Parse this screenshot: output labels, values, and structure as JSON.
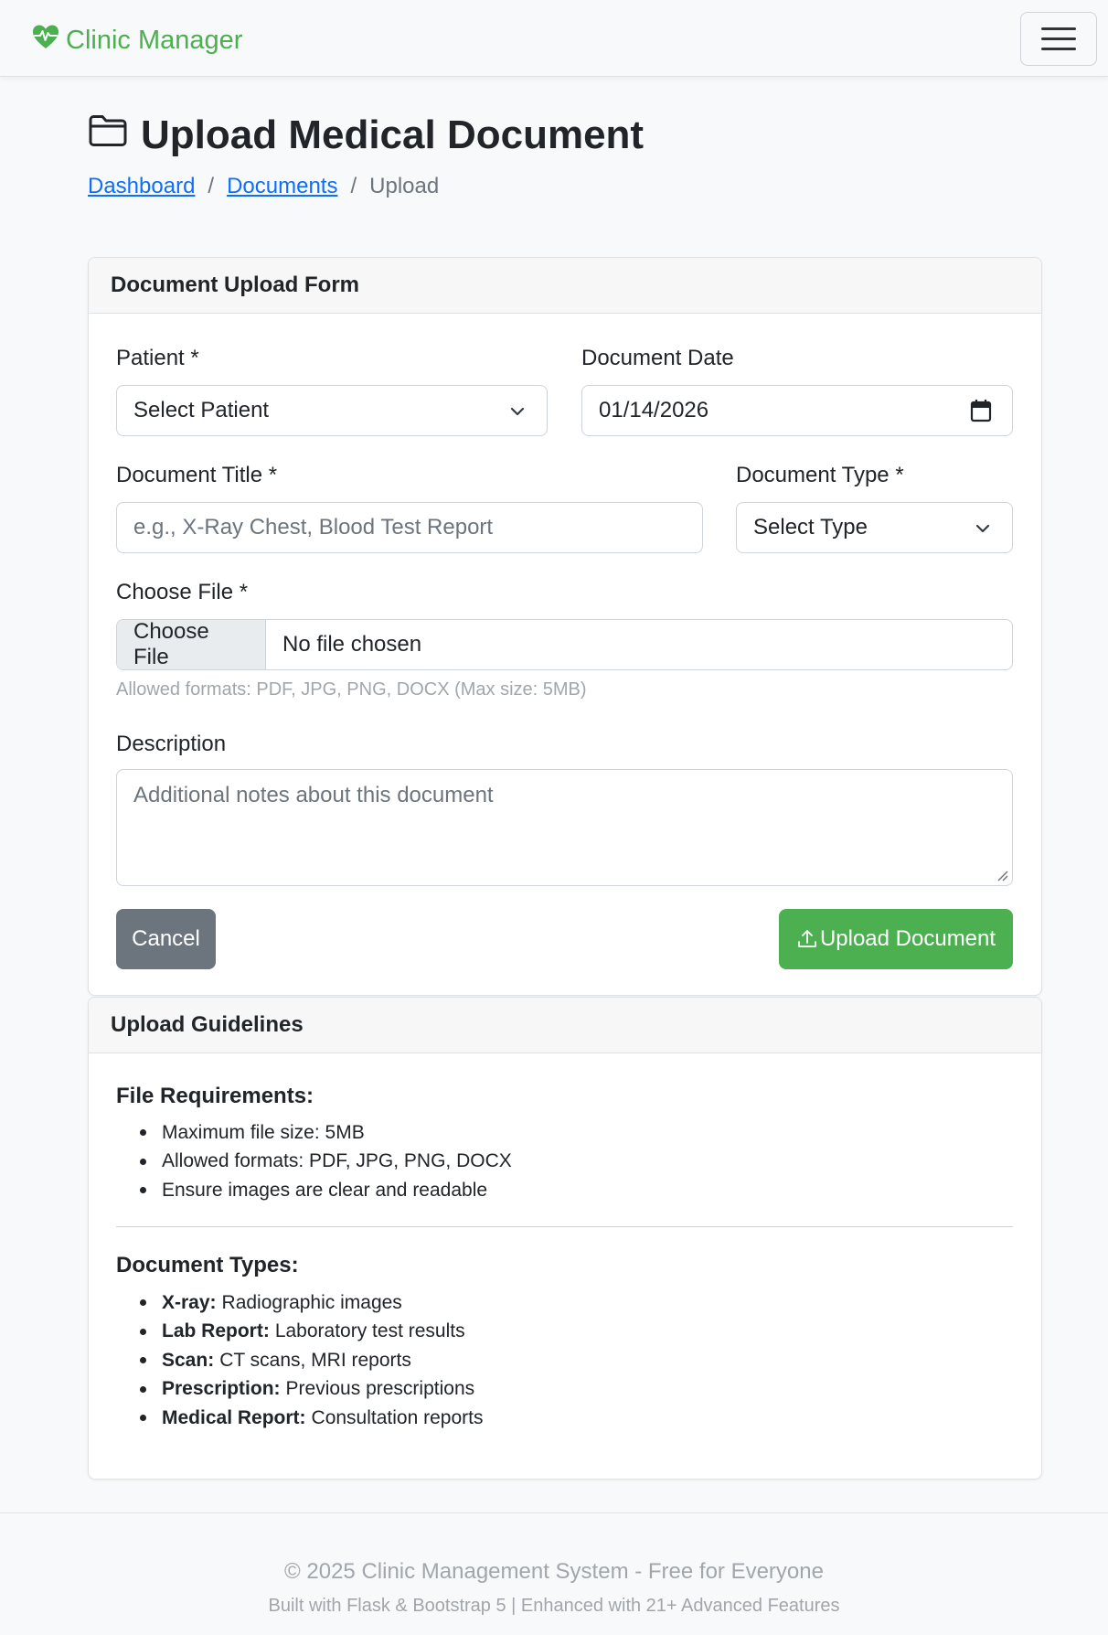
{
  "navbar": {
    "brand": "Clinic Manager",
    "brand_color": "#4caf50",
    "brand_icon": "heart-pulse-icon",
    "toggler_icon": "hamburger-icon"
  },
  "header": {
    "title": "Upload Medical Document",
    "title_icon": "folder-icon",
    "breadcrumb": [
      "Dashboard",
      "Documents",
      "Upload"
    ],
    "breadcrumb_sep": "/"
  },
  "form": {
    "title": "Document Upload Form",
    "patient_label": "Patient *",
    "patient_value": "Select Patient",
    "date_label": "Document Date",
    "date_value": "01/14/2026",
    "doc_title_label": "Document Title *",
    "doc_title_placeholder": "e.g., X-Ray Chest, Blood Test Report",
    "doc_type_label": "Document Type *",
    "doc_type_value": "Select Type",
    "file_label": "Choose File *",
    "file_button": "Choose File",
    "file_status": "No file chosen",
    "file_hint": "Allowed formats: PDF, JPG, PNG, DOCX (Max size: 5MB)",
    "description_label": "Description",
    "description_placeholder": "Additional notes about this document",
    "cancel_label": "Cancel",
    "upload_label": "Upload Document",
    "accent_color": "#4caf50"
  },
  "guidelines": {
    "title": "Upload Guidelines",
    "file_req_heading": "File Requirements:",
    "file_req": [
      "Maximum file size: 5MB",
      "Allowed formats: PDF, JPG, PNG, DOCX",
      "Ensure images are clear and readable"
    ],
    "doc_types_heading": "Document Types:",
    "doc_types": [
      {
        "term": "X-ray:",
        "desc": "Radiographic images"
      },
      {
        "term": "Lab Report:",
        "desc": "Laboratory test results"
      },
      {
        "term": "Scan:",
        "desc": "CT scans, MRI reports"
      },
      {
        "term": "Prescription:",
        "desc": "Previous prescriptions"
      },
      {
        "term": "Medical Report:",
        "desc": "Consultation reports"
      }
    ]
  },
  "footer": {
    "line1": "© 2025 Clinic Management System - Free for Everyone",
    "line2": "Built with Flask & Bootstrap 5 | Enhanced with 21+ Advanced Features"
  }
}
